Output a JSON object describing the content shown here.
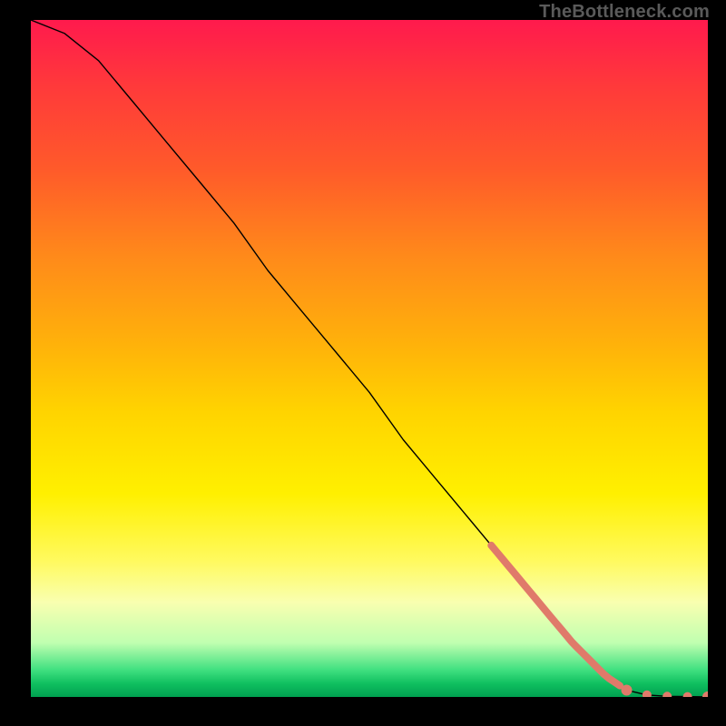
{
  "watermark": "TheBottleneck.com",
  "chart_data": {
    "type": "line",
    "title": "",
    "xlabel": "",
    "ylabel": "",
    "xlim": [
      0,
      100
    ],
    "ylim": [
      0,
      100
    ],
    "grid": false,
    "legend": false,
    "series": [
      {
        "name": "curve",
        "x": [
          0,
          5,
          10,
          15,
          20,
          25,
          30,
          35,
          40,
          45,
          50,
          55,
          60,
          65,
          70,
          75,
          80,
          85,
          88,
          91,
          94,
          97,
          100
        ],
        "y": [
          100,
          98,
          94,
          88,
          82,
          76,
          70,
          63,
          57,
          51,
          45,
          38,
          32,
          26,
          20,
          14,
          8,
          3,
          1,
          0.3,
          0.1,
          0.05,
          0.02
        ]
      }
    ],
    "highlight_range_x": [
      68,
      87
    ],
    "endpoint_dots_x": [
      88,
      91,
      94,
      97,
      100
    ]
  },
  "colors": {
    "curve_stroke": "#000000",
    "highlight_stroke": "#e07a6a",
    "dot_fill": "#e07a6a",
    "background": "#000000"
  }
}
